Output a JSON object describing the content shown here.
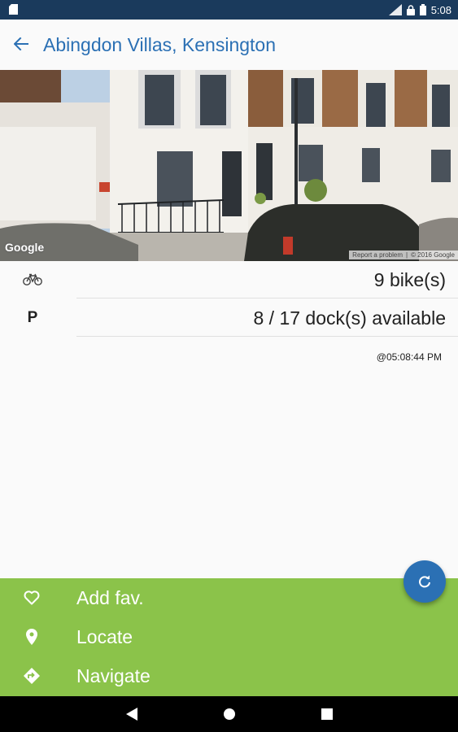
{
  "status_bar": {
    "time": "5:08"
  },
  "app_bar": {
    "title": "Abingdon Villas, Kensington"
  },
  "street_view": {
    "google_logo": "Google",
    "report_text": "Report a problem",
    "copyright": "© 2016 Google"
  },
  "station": {
    "bikes": "9 bike(s)",
    "dock_icon_label": "P",
    "docks": "8 / 17 dock(s) available",
    "timestamp": "@05:08:44 PM"
  },
  "actions": [
    {
      "label": "Add fav.",
      "icon": "heart-outline-icon"
    },
    {
      "label": "Locate",
      "icon": "map-pin-icon"
    },
    {
      "label": "Navigate",
      "icon": "directions-icon"
    }
  ],
  "fab": {
    "icon": "refresh-icon"
  },
  "colors": {
    "primary": "#2b70b4",
    "status_bar": "#1a3a5c",
    "action_panel": "#8bc34a"
  }
}
